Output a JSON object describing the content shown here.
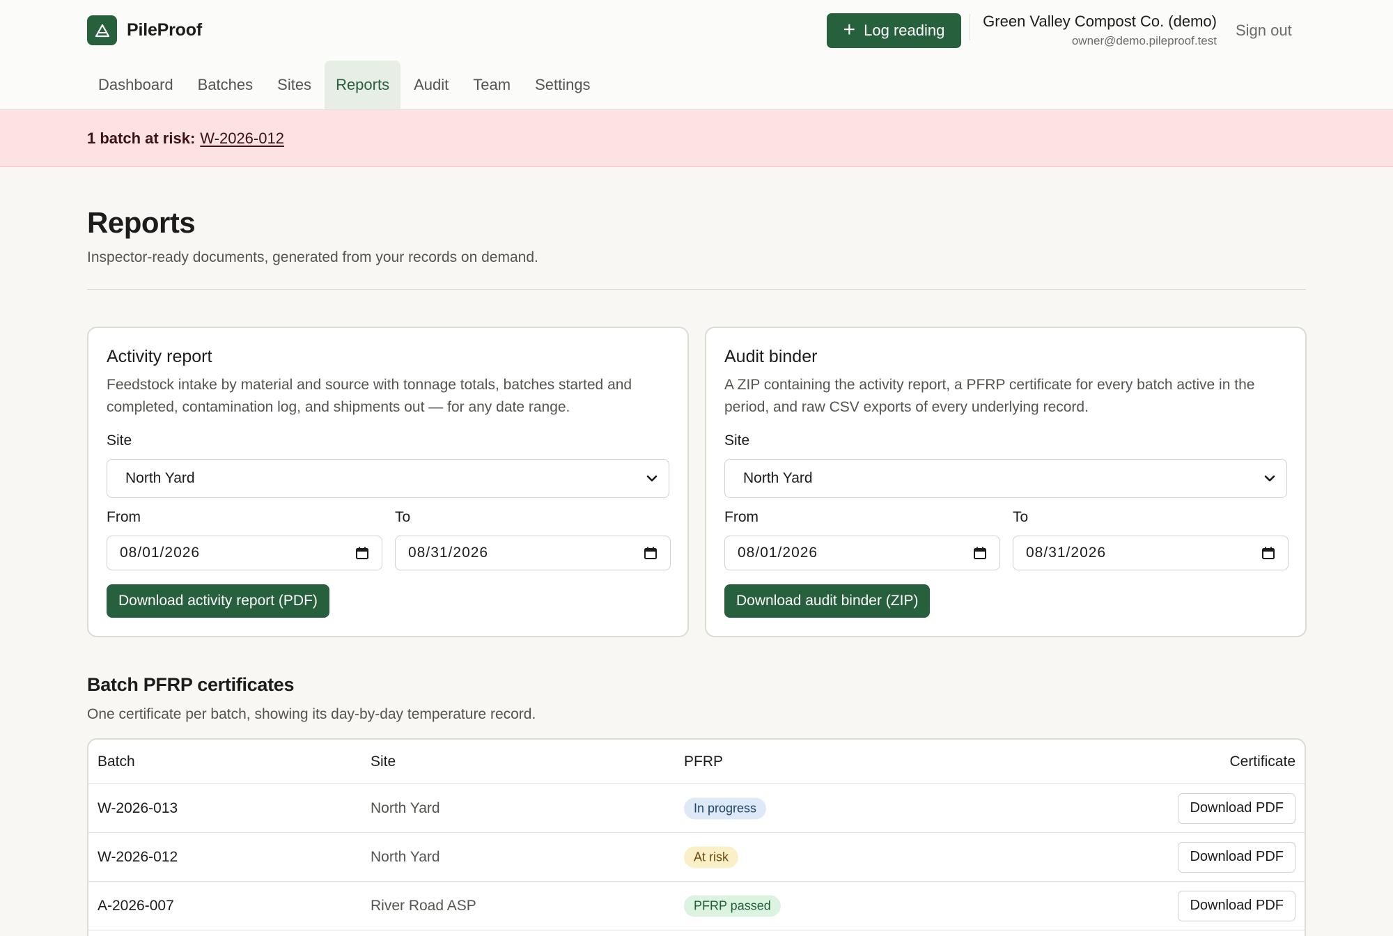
{
  "app": {
    "name": "PileProof",
    "logo_icon": "triangle-icon",
    "brand_color": "#27603d"
  },
  "header": {
    "log_reading_label": "Log reading",
    "user_name": "Green Valley Compost Co. (demo)",
    "user_email": "owner@demo.pileproof.test",
    "sign_out_label": "Sign out"
  },
  "nav": {
    "items": [
      {
        "label": "Dashboard",
        "active": false
      },
      {
        "label": "Batches",
        "active": false
      },
      {
        "label": "Sites",
        "active": false
      },
      {
        "label": "Reports",
        "active": true
      },
      {
        "label": "Audit",
        "active": false
      },
      {
        "label": "Team",
        "active": false
      },
      {
        "label": "Settings",
        "active": false
      }
    ]
  },
  "alert": {
    "prefix": "1 batch at risk:",
    "link": "W-2026-012"
  },
  "page": {
    "title": "Reports",
    "subtitle": "Inspector-ready documents, generated from your records on demand."
  },
  "activity_card": {
    "title": "Activity report",
    "description": "Feedstock intake by material and source with tonnage totals, batches started and completed, contamination log, and shipments out — for any date range.",
    "site_label": "Site",
    "site_value": "North Yard",
    "from_label": "From",
    "from_value": "08/01/2026",
    "to_label": "To",
    "to_value": "08/31/2026",
    "button_label": "Download activity report (PDF)"
  },
  "audit_card": {
    "title": "Audit binder",
    "description": "A ZIP containing the activity report, a PFRP certificate for every batch active in the period, and raw CSV exports of every underlying record.",
    "site_label": "Site",
    "site_value": "North Yard",
    "from_label": "From",
    "from_value": "08/01/2026",
    "to_label": "To",
    "to_value": "08/31/2026",
    "button_label": "Download audit binder (ZIP)"
  },
  "certificates": {
    "title": "Batch PFRP certificates",
    "subtitle": "One certificate per batch, showing its day-by-day temperature record.",
    "columns": [
      "Batch",
      "Site",
      "PFRP",
      "Certificate"
    ],
    "rows": [
      {
        "batch": "W-2026-013",
        "site": "North Yard",
        "status": "In progress",
        "status_color": "#dde9f7",
        "action": "Download PDF"
      },
      {
        "batch": "W-2026-012",
        "site": "North Yard",
        "status": "At risk",
        "status_color": "#fbefc7",
        "action": "Download PDF"
      },
      {
        "batch": "A-2026-007",
        "site": "River Road ASP",
        "status": "PFRP passed",
        "status_color": "#dcf3e2",
        "action": "Download PDF"
      }
    ]
  }
}
